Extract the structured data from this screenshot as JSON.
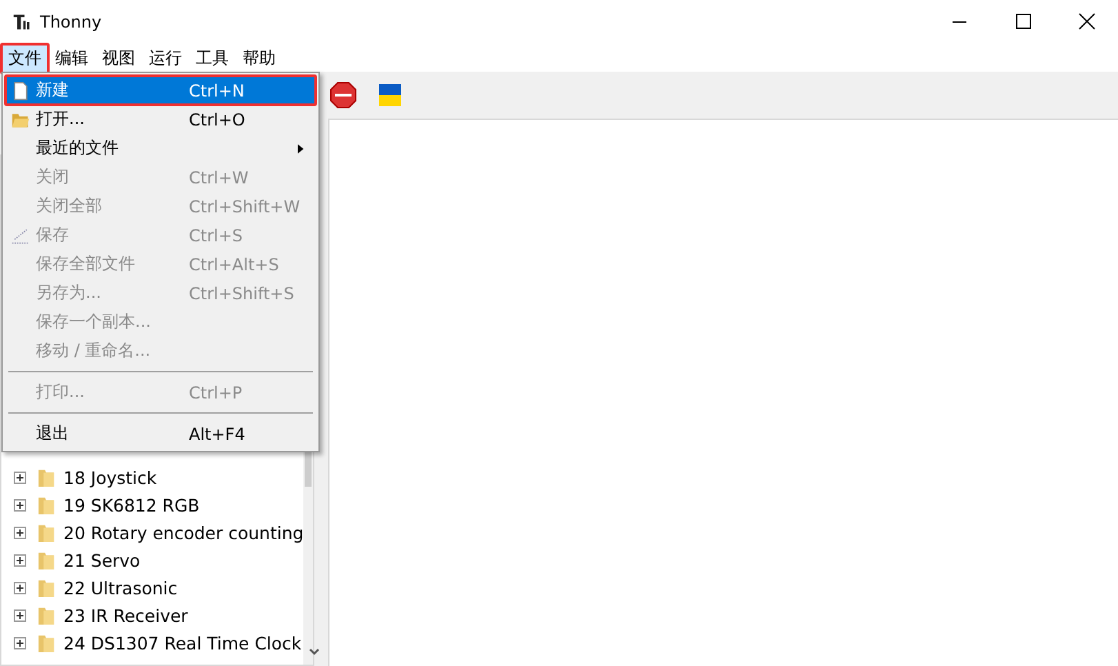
{
  "window": {
    "title": "Thonny"
  },
  "menubar": [
    {
      "label": "文件",
      "selected": true,
      "highlighted": true
    },
    {
      "label": "编辑",
      "selected": false,
      "highlighted": false
    },
    {
      "label": "视图",
      "selected": false,
      "highlighted": false
    },
    {
      "label": "运行",
      "selected": false,
      "highlighted": false
    },
    {
      "label": "工具",
      "selected": false,
      "highlighted": false
    },
    {
      "label": "帮助",
      "selected": false,
      "highlighted": false
    }
  ],
  "file_menu": [
    {
      "kind": "new",
      "label": "新建",
      "shortcut": "Ctrl+N",
      "disabled": false,
      "selected": true,
      "highlighted": true
    },
    {
      "kind": "open",
      "label": "打开...",
      "shortcut": "Ctrl+O",
      "disabled": false,
      "selected": false,
      "highlighted": false
    },
    {
      "kind": "submenu",
      "label": "最近的文件",
      "disabled": false,
      "selected": false,
      "highlighted": false
    },
    {
      "kind": "item",
      "label": "关闭",
      "shortcut": "Ctrl+W",
      "disabled": true,
      "selected": false,
      "highlighted": false
    },
    {
      "kind": "item",
      "label": "关闭全部",
      "shortcut": "Ctrl+Shift+W",
      "disabled": true,
      "selected": false,
      "highlighted": false
    },
    {
      "kind": "save",
      "label": "保存",
      "shortcut": "Ctrl+S",
      "disabled": true,
      "selected": false,
      "highlighted": false
    },
    {
      "kind": "item",
      "label": "保存全部文件",
      "shortcut": "Ctrl+Alt+S",
      "disabled": true,
      "selected": false,
      "highlighted": false
    },
    {
      "kind": "item",
      "label": "另存为...",
      "shortcut": "Ctrl+Shift+S",
      "disabled": true,
      "selected": false,
      "highlighted": false
    },
    {
      "kind": "item",
      "label": "保存一个副本...",
      "disabled": true,
      "selected": false,
      "highlighted": false
    },
    {
      "kind": "item",
      "label": "移动 / 重命名...",
      "disabled": true,
      "selected": false,
      "highlighted": false
    },
    {
      "kind": "separator"
    },
    {
      "kind": "item",
      "label": "打印...",
      "shortcut": "Ctrl+P",
      "disabled": true,
      "selected": false,
      "highlighted": false
    },
    {
      "kind": "separator"
    },
    {
      "kind": "item",
      "label": "退出",
      "shortcut": "Alt+F4",
      "disabled": false,
      "selected": false,
      "highlighted": false
    }
  ],
  "toolbar": [
    {
      "kind": "stop"
    },
    {
      "kind": "flag"
    }
  ],
  "file_tree": [
    {
      "label": "18 Joystick",
      "expanded": false
    },
    {
      "label": "19 SK6812 RGB",
      "expanded": false
    },
    {
      "label": "20 Rotary encoder counting",
      "expanded": false
    },
    {
      "label": "21 Servo",
      "expanded": false
    },
    {
      "label": "22 Ultrasonic",
      "expanded": false
    },
    {
      "label": "23 IR Receiver",
      "expanded": false
    },
    {
      "label": "24 DS1307 Real Time Clock",
      "expanded": false
    }
  ]
}
